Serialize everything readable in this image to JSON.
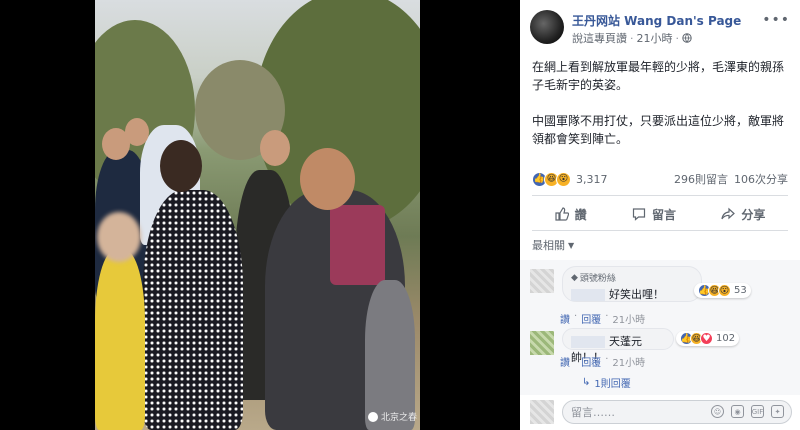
{
  "post": {
    "page_name": "王丹网站 Wang Dan's Page",
    "suggest_label": "說這專頁讚",
    "time": "21小時",
    "text_para1": "在網上看到解放軍最年輕的少將，毛澤東的親孫子毛新宇的英姿。",
    "text_para2": "中國軍隊不用打仗，只要派出這位少將，敵軍將領都會笑到陣亡。",
    "reactions_count": "3,317",
    "comments_count": "296則留言",
    "shares_count": "106次分享"
  },
  "actions": {
    "like": "讚",
    "comment": "留言",
    "share": "分享"
  },
  "sort_label": "最相關",
  "comments": [
    {
      "badge": "頭號粉絲",
      "text": "好笑出哩！",
      "reactions_count": "53",
      "like_label": "讚",
      "reply_label": "回覆",
      "time": "21小時"
    },
    {
      "text": "天蓬元帥！！",
      "reactions_count": "102",
      "like_label": "讚",
      "reply_label": "回覆",
      "time": "21小時",
      "replies_link": "1則回覆"
    }
  ],
  "compose": {
    "placeholder": "留言……"
  },
  "photo": {
    "watermark": "北京之春"
  },
  "colors": {
    "link": "#385898",
    "like_blue": "#4267b2",
    "panel_bg": "#ffffff",
    "viewer_bg": "#000000"
  }
}
